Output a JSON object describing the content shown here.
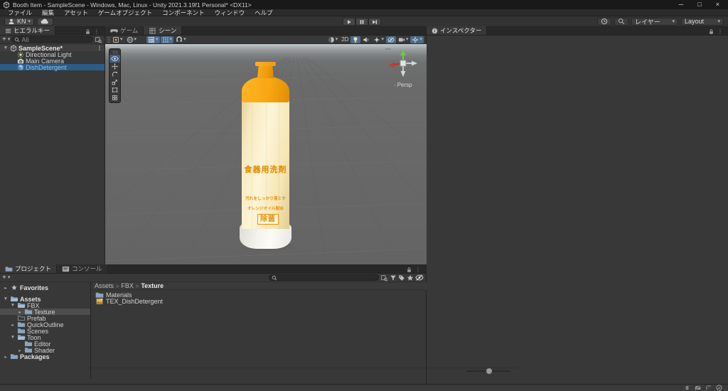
{
  "window": {
    "title": "Booth Item - SampleScene - Windows, Mac, Linux - Unity 2021.3.19f1 Personal* <DX11>",
    "controls": {
      "minimize": "─",
      "maximize": "□",
      "close": "×"
    }
  },
  "menu_bar": {
    "items": [
      "ファイル",
      "編集",
      "アセット",
      "ゲームオブジェクト",
      "コンポーネント",
      "ウィンドウ",
      "ヘルプ"
    ]
  },
  "toolbar": {
    "account_label": "KN",
    "play_controls": [
      {
        "icon": "play",
        "name": "play-button"
      },
      {
        "icon": "pause",
        "name": "pause-button"
      },
      {
        "icon": "step",
        "name": "step-button"
      }
    ],
    "layers_label": "レイヤー",
    "layout_label": "Layout"
  },
  "hierarchy": {
    "tab": "ヒエラルキー",
    "search_label": "All",
    "rows": [
      {
        "label": "SampleScene*",
        "icon": "unity",
        "arrow": "▼",
        "header": true
      },
      {
        "label": "Directional Light",
        "icon": "light"
      },
      {
        "label": "Main Camera",
        "icon": "camera"
      },
      {
        "label": "DishDetergent",
        "icon": "prefab-cube",
        "selected": true,
        "prefab": true
      }
    ]
  },
  "scene_view": {
    "tabs": [
      {
        "label": "ゲーム",
        "icon": "gamepad",
        "active": false
      },
      {
        "label": "シーン",
        "icon": "scene",
        "active": true
      }
    ],
    "toolbar_left": [
      {
        "icon": "tool-settings",
        "dropdown": true,
        "name": "tool-settings-dropdown"
      },
      {
        "icon": "globe",
        "dropdown": true,
        "name": "grid-visibility-dropdown"
      },
      {
        "gap": true
      },
      {
        "icon": "grid-snap",
        "dropdown": true,
        "active": true,
        "name": "grid-snapping-toggle"
      },
      {
        "icon": "grid-dots",
        "dropdown": true,
        "active": true,
        "name": "increment-snap-toggle"
      },
      {
        "icon": "magnet",
        "dropdown": true,
        "name": "snap-settings-dropdown"
      }
    ],
    "toolbar_right": [
      {
        "icon": "shading",
        "dropdown": true,
        "name": "draw-mode-dropdown"
      },
      {
        "label": "2D",
        "name": "2d-toggle"
      },
      {
        "icon": "bulb",
        "active": true,
        "name": "lighting-toggle"
      },
      {
        "icon": "speaker",
        "name": "audio-toggle"
      },
      {
        "icon": "sparkle",
        "dropdown": true,
        "name": "effects-dropdown"
      },
      {
        "icon": "eye-slash",
        "active": true,
        "name": "scene-visibility-toggle"
      },
      {
        "icon": "cam",
        "dropdown": true,
        "name": "camera-settings-dropdown"
      },
      {
        "icon": "gizmo",
        "active": true,
        "dropdown": true,
        "name": "gizmos-dropdown"
      }
    ],
    "tools": [
      {
        "icon": "eye",
        "active": true,
        "name": "view-tool"
      },
      {
        "icon": "move",
        "name": "move-tool"
      },
      {
        "icon": "rotate",
        "name": "rotate-tool"
      },
      {
        "icon": "scale",
        "name": "scale-tool"
      },
      {
        "icon": "rect-tool",
        "name": "rect-tool"
      },
      {
        "icon": "transform",
        "name": "transform-tool"
      }
    ],
    "gizmo_label": "Persp",
    "bottle": {
      "title": "食器用洗剤",
      "line1": "汚れをしっかり落とす",
      "line2": "オレンジオイル配合",
      "badge": "除菌"
    }
  },
  "inspector": {
    "tab": "インスペクター"
  },
  "project": {
    "tabs": [
      {
        "label": "プロジェクト",
        "icon": "folder",
        "active": true
      },
      {
        "label": "コンソール",
        "icon": "console",
        "active": false
      }
    ],
    "breadcrumb": [
      "Assets",
      "FBX",
      "Texture"
    ],
    "tree": [
      {
        "label": "Favorites",
        "icon": "star",
        "arrow": "▸",
        "depth": 0,
        "bold": true
      },
      {
        "label": "Assets",
        "icon": "folder-open",
        "arrow": "▼",
        "depth": 0,
        "bold": true
      },
      {
        "label": "FBX",
        "icon": "folder-open",
        "arrow": "▼",
        "depth": 1
      },
      {
        "label": "Texture",
        "icon": "folder",
        "arrow": "▸",
        "depth": 2,
        "selected": true
      },
      {
        "label": "Prefab",
        "icon": "folder-empty",
        "arrow": "",
        "depth": 1
      },
      {
        "label": "QuickOutline",
        "icon": "folder",
        "arrow": "▸",
        "depth": 1
      },
      {
        "label": "Scenes",
        "icon": "folder",
        "arrow": "",
        "depth": 1
      },
      {
        "label": "Toon",
        "icon": "folder-open",
        "arrow": "▼",
        "depth": 1
      },
      {
        "label": "Editor",
        "icon": "folder",
        "arrow": "",
        "depth": 2
      },
      {
        "label": "Shader",
        "icon": "folder",
        "arrow": "▸",
        "depth": 2
      },
      {
        "label": "Packages",
        "icon": "folder",
        "arrow": "▸",
        "depth": 0,
        "bold": true
      }
    ],
    "content": [
      {
        "label": "Materials",
        "icon": "folder"
      },
      {
        "label": "TEX_DishDetergent",
        "icon": "texture"
      }
    ]
  },
  "status_bar": {
    "icons": [
      "bell-slash",
      "mail-slash",
      "refresh-slash",
      "check-circle"
    ]
  },
  "colors": {
    "selection_blue": "#2c5d87",
    "prefab_text": "#8cc1ea",
    "accent_orange": "#f5a00f",
    "panel_bg": "#383838",
    "viewport_gray": "#6b6b6b"
  }
}
